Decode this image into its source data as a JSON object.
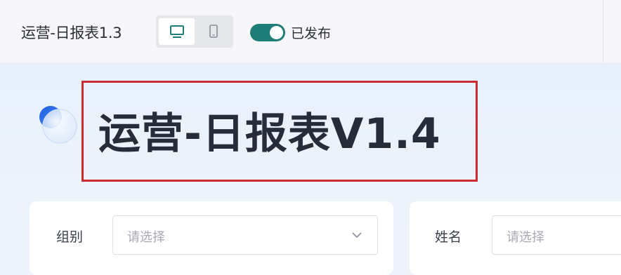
{
  "topbar": {
    "app_title": "运营-日报表1.3",
    "device_toggle": [
      "desktop-icon",
      "mobile-icon"
    ],
    "publish_toggle": {
      "on": true,
      "label": "已发布",
      "color": "#1f7d77"
    }
  },
  "hero": {
    "title": "运营-日报表V1.4",
    "highlight_color": "#cc2a31"
  },
  "filters": [
    {
      "label": "组别",
      "placeholder": "请选择"
    },
    {
      "label": "姓名",
      "placeholder": "请选择"
    }
  ]
}
